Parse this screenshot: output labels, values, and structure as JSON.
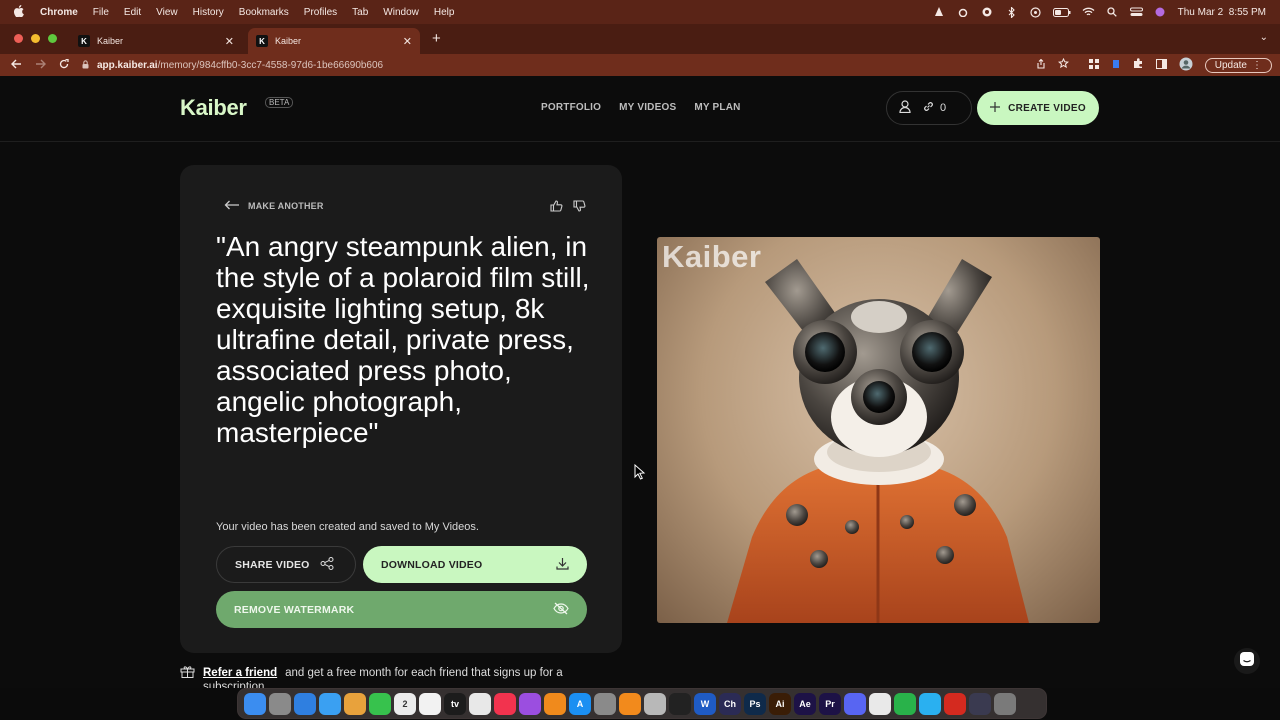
{
  "menubar": {
    "items": [
      "Chrome",
      "File",
      "Edit",
      "View",
      "History",
      "Bookmarks",
      "Profiles",
      "Tab",
      "Window",
      "Help"
    ],
    "datetime": "Thu Mar 2  8:55 PM"
  },
  "tabs": [
    {
      "title": "Kaiber",
      "active": false
    },
    {
      "title": "Kaiber",
      "active": true
    }
  ],
  "toolbar": {
    "url_host": "app.kaiber.ai",
    "url_path": "/memory/984cffb0-3cc7-4558-97d6-1be66690b606",
    "update_label": "Update"
  },
  "site": {
    "logo": "Kaiber",
    "beta": "BETA",
    "nav": [
      "PORTFOLIO",
      "MY VIDEOS",
      "MY PLAN"
    ],
    "credits": "0",
    "create_label": "CREATE VIDEO"
  },
  "card": {
    "make_another": "MAKE ANOTHER",
    "prompt": "\"An angry steampunk alien, in the style of a polaroid film still, exquisite lighting setup, 8k ultrafine detail, private press, associated press photo, angelic photograph, masterpiece\"",
    "saved_msg": "Your video has been created and saved to My Videos.",
    "share_label": "SHARE VIDEO",
    "download_label": "DOWNLOAD VIDEO",
    "watermark_label": "REMOVE WATERMARK"
  },
  "video": {
    "watermark_text": "Kaiber"
  },
  "referral": {
    "link": "Refer a friend",
    "text": "and get a free month for each friend that signs up for a",
    "text2": "subscription"
  },
  "colors": {
    "accent": "#c9f7c0",
    "watermark_btn": "#6fa96d",
    "chrome_frame": "#6f2d1c"
  },
  "dock": {
    "icons": [
      {
        "name": "finder",
        "color": "#3b8df0",
        "glyph": ""
      },
      {
        "name": "launchpad",
        "color": "#8a8a8a",
        "glyph": ""
      },
      {
        "name": "safari",
        "color": "#2f7fe0",
        "glyph": ""
      },
      {
        "name": "mail",
        "color": "#3aa0f2",
        "glyph": ""
      },
      {
        "name": "photos",
        "color": "#e8a23c",
        "glyph": ""
      },
      {
        "name": "messages",
        "color": "#37c24d",
        "glyph": ""
      },
      {
        "name": "calendar",
        "color": "#ececec",
        "glyph": "2"
      },
      {
        "name": "reminders",
        "color": "#f2f2f2",
        "glyph": ""
      },
      {
        "name": "tv",
        "color": "#1c1c1c",
        "glyph": "tv"
      },
      {
        "name": "chrome",
        "color": "#e8e8e8",
        "glyph": ""
      },
      {
        "name": "music",
        "color": "#f2334e",
        "glyph": ""
      },
      {
        "name": "podcasts",
        "color": "#9b4ee0",
        "glyph": ""
      },
      {
        "name": "vlc",
        "color": "#f08a1c",
        "glyph": ""
      },
      {
        "name": "app-store",
        "color": "#1b8ff2",
        "glyph": "A"
      },
      {
        "name": "settings",
        "color": "#8a8a8a",
        "glyph": ""
      },
      {
        "name": "books",
        "color": "#f28a1c",
        "glyph": ""
      },
      {
        "name": "preview",
        "color": "#b8b8b8",
        "glyph": ""
      },
      {
        "name": "capcut",
        "color": "#222222",
        "glyph": ""
      },
      {
        "name": "word",
        "color": "#1f5bc4",
        "glyph": "W"
      },
      {
        "name": "character",
        "color": "#2b2b55",
        "glyph": "Ch"
      },
      {
        "name": "photoshop",
        "color": "#0f2a4a",
        "glyph": "Ps"
      },
      {
        "name": "illustrator",
        "color": "#3a1d06",
        "glyph": "Ai"
      },
      {
        "name": "after-effects",
        "color": "#1d1246",
        "glyph": "Ae"
      },
      {
        "name": "premiere",
        "color": "#1d1246",
        "glyph": "Pr"
      },
      {
        "name": "discord",
        "color": "#5865f2",
        "glyph": ""
      },
      {
        "name": "textedit",
        "color": "#e9e9e9",
        "glyph": ""
      },
      {
        "name": "whatsapp",
        "color": "#29b24a",
        "glyph": ""
      },
      {
        "name": "testflight",
        "color": "#2ab0f0",
        "glyph": ""
      },
      {
        "name": "acrobat",
        "color": "#d42a1f",
        "glyph": ""
      },
      {
        "name": "obs",
        "color": "#3a3a50",
        "glyph": ""
      },
      {
        "name": "trash",
        "color": "#7a7a7a",
        "glyph": ""
      }
    ]
  }
}
